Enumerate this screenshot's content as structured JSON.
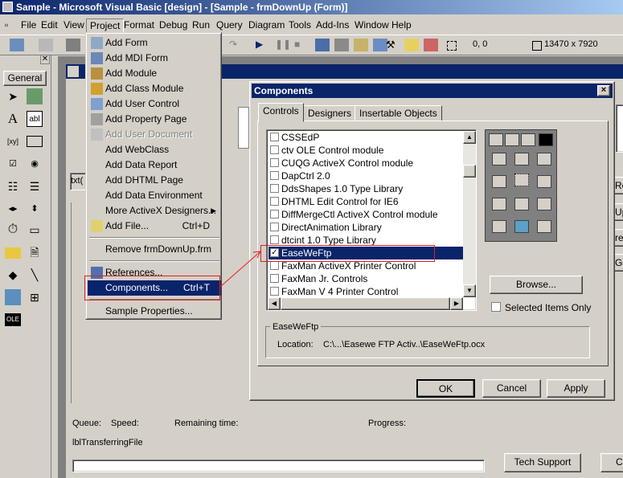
{
  "window": {
    "title": "Sample - Microsoft Visual Basic [design] - [Sample - frmDownUp (Form)]"
  },
  "menubar": [
    "File",
    "Edit",
    "View",
    "Project",
    "Format",
    "Debug",
    "Run",
    "Query",
    "Diagram",
    "Tools",
    "Add-Ins",
    "Window",
    "Help"
  ],
  "toolbar": {
    "position": "0, 0",
    "size": "13470 x 7920"
  },
  "toolbox": {
    "title": "General"
  },
  "project_menu": {
    "items": [
      {
        "label": "Add Form",
        "shortcut": ""
      },
      {
        "label": "Add MDI Form",
        "shortcut": ""
      },
      {
        "label": "Add Module",
        "shortcut": ""
      },
      {
        "label": "Add Class Module",
        "shortcut": ""
      },
      {
        "label": "Add User Control",
        "shortcut": ""
      },
      {
        "label": "Add Property Page",
        "shortcut": ""
      },
      {
        "label": "Add User Document",
        "shortcut": ""
      },
      {
        "label": "Add WebClass",
        "shortcut": ""
      },
      {
        "label": "Add Data Report",
        "shortcut": ""
      },
      {
        "label": "Add DHTML Page",
        "shortcut": ""
      },
      {
        "label": "Add Data Environment",
        "shortcut": ""
      },
      {
        "label": "More ActiveX Designers...",
        "shortcut": ""
      },
      {
        "label": "Add File...",
        "shortcut": "Ctrl+D"
      },
      {
        "label": "Remove frmDownUp.frm",
        "shortcut": ""
      },
      {
        "label": "References...",
        "shortcut": ""
      },
      {
        "label": "Components...",
        "shortcut": "Ctrl+T"
      },
      {
        "label": "Sample Properties...",
        "shortcut": ""
      }
    ]
  },
  "dialog": {
    "title": "Components",
    "close": "×",
    "tabs": [
      "Controls",
      "Designers",
      "Insertable Objects"
    ],
    "components": [
      {
        "label": "CSSEdP",
        "checked": false
      },
      {
        "label": "ctv OLE Control module",
        "checked": false
      },
      {
        "label": "CUQG ActiveX Control module",
        "checked": false
      },
      {
        "label": "DapCtrl 2.0",
        "checked": false
      },
      {
        "label": "DdsShapes 1.0 Type Library",
        "checked": false
      },
      {
        "label": "DHTML Edit Control for IE6",
        "checked": false
      },
      {
        "label": "DiffMergeCtl ActiveX Control module",
        "checked": false
      },
      {
        "label": "DirectAnimation Library",
        "checked": false
      },
      {
        "label": "dtcint 1.0 Type Library",
        "checked": false
      },
      {
        "label": "EaseWeFtp",
        "checked": true
      },
      {
        "label": "FaxMan ActiveX Printer Control",
        "checked": false
      },
      {
        "label": "FaxMan Jr. Controls",
        "checked": false
      },
      {
        "label": "FaxMan V 4 Printer Control",
        "checked": false
      }
    ],
    "browse": "Browse...",
    "selected_only": "Selected Items Only",
    "group_title": "EaseWeFtp",
    "location_label": "Location:",
    "location_value": "C:\\...\\Easewe FTP Activ..\\EaseWeFtp.ocx",
    "ok": "OK",
    "cancel": "Cancel",
    "apply": "Apply"
  },
  "form": {
    "textbox_prefix": "txt(",
    "queue": "Queue:",
    "speed": "Speed:",
    "remaining": "Remaining time:",
    "progress": "Progress:",
    "lbl_transferring": "lblTransferringFile",
    "tech_support": "Tech Support",
    "right_partial": [
      "Re",
      "Up",
      "rea",
      "Ge",
      "C"
    ]
  },
  "colors": {
    "title_active": "#0a246a",
    "selection": "#0a246a",
    "annotation": "#e02020"
  }
}
